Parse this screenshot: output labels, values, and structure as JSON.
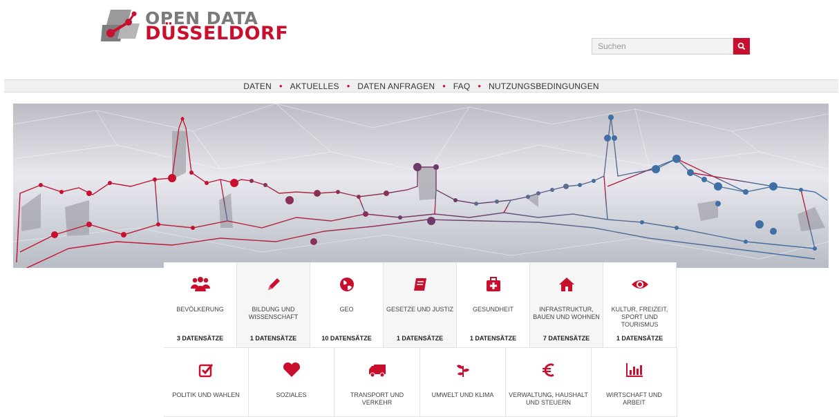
{
  "logo": {
    "line1": "OPEN DATA",
    "line2": "DÜSSELDORF"
  },
  "search": {
    "placeholder": "Suchen",
    "button_icon": "search-icon"
  },
  "nav": {
    "items": [
      "DATEN",
      "AKTUELLES",
      "DATEN ANFRAGEN",
      "FAQ",
      "NUTZUNGSBEDINGUNGEN"
    ],
    "separator": "•"
  },
  "hero": {
    "image": "duesseldorf-skyline-network-illustration"
  },
  "colors": {
    "accent": "#c8102e",
    "purple": "#7a3e6e",
    "blue": "#3f6fa3"
  },
  "categories": [
    {
      "label": "BEVÖLKERUNG",
      "count": "3 DATENSÄTZE",
      "icon": "users-icon"
    },
    {
      "label": "BILDUNG UND WISSENSCHAFT",
      "count": "1 DATENSÄTZE",
      "icon": "pencil-icon"
    },
    {
      "label": "GEO",
      "count": "10 DATENSÄTZE",
      "icon": "globe-icon"
    },
    {
      "label": "GESETZE UND JUSTIZ",
      "count": "1 DATENSÄTZE",
      "icon": "book-icon"
    },
    {
      "label": "GESUNDHEIT",
      "count": "1 DATENSÄTZE",
      "icon": "medkit-icon"
    },
    {
      "label": "INFRASTRUKTUR, BAUEN UND WOHNEN",
      "count": "7 DATENSÄTZE",
      "icon": "home-icon"
    },
    {
      "label": "KULTUR, FREIZEIT, SPORT UND TOURISMUS",
      "count": "1 DATENSÄTZE",
      "icon": "eye-icon"
    },
    {
      "label": "POLITIK UND WAHLEN",
      "icon": "checkbox-icon"
    },
    {
      "label": "SOZIALES",
      "icon": "heart-icon"
    },
    {
      "label": "TRANSPORT UND VERKEHR",
      "icon": "truck-icon"
    },
    {
      "label": "UMWELT UND KLIMA",
      "icon": "leaf-icon"
    },
    {
      "label": "VERWALTUNG, HAUSHALT UND STEUERN",
      "icon": "euro-icon"
    },
    {
      "label": "WIRTSCHAFT UND ARBEIT",
      "icon": "bar-chart-icon"
    }
  ]
}
